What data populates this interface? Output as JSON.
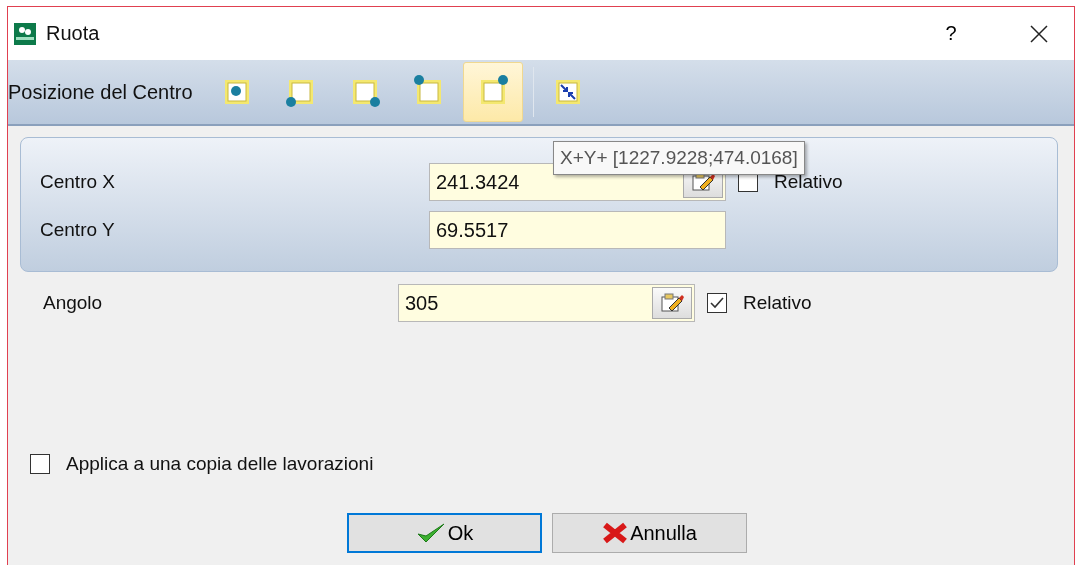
{
  "window": {
    "title": "Ruota",
    "help": "?"
  },
  "toolbar": {
    "label": "Posizione del Centro",
    "positions": [
      {
        "kind": "center",
        "selected": false
      },
      {
        "kind": "bottom-left",
        "selected": false
      },
      {
        "kind": "bottom-right",
        "selected": false
      },
      {
        "kind": "top-left",
        "selected": false
      },
      {
        "kind": "top-right",
        "selected": true
      }
    ]
  },
  "center_group": {
    "rows": [
      {
        "label": "Centro X",
        "value": "241.3424",
        "edit_button": true,
        "relative": {
          "label": "Relativo",
          "checked": false
        }
      },
      {
        "label": "Centro Y",
        "value": "69.5517",
        "edit_button": false
      }
    ]
  },
  "tooltip": "X+Y+ [1227.9228;474.0168]",
  "angle": {
    "label": "Angolo",
    "value": "305",
    "edit_button": true,
    "relative": {
      "label": "Relativo",
      "checked": true
    }
  },
  "apply_copy": {
    "label": "Applica a una copia delle lavorazioni",
    "checked": false
  },
  "buttons": [
    {
      "kind": "ok",
      "label": "Ok",
      "default": true
    },
    {
      "kind": "cancel",
      "label": "Annulla",
      "default": false
    }
  ]
}
